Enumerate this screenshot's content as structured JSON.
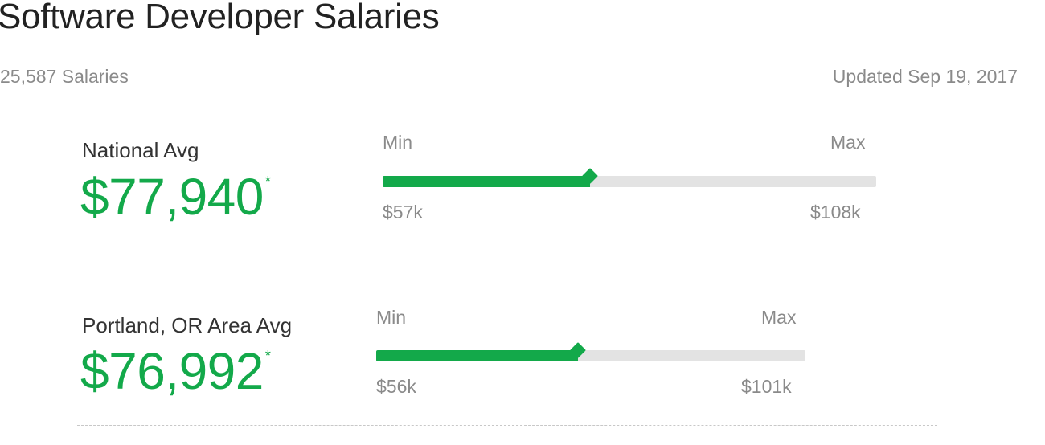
{
  "header": {
    "title": "Software Developer Salaries",
    "salary_count": "25,587 Salaries",
    "updated": "Updated Sep 19, 2017"
  },
  "rows": [
    {
      "label": "National Avg",
      "average": "$77,940",
      "asterisk": "*",
      "min_label": "Min",
      "max_label": "Max",
      "min_value": "$57k",
      "max_value": "$108k",
      "percentile_fill": 0.42
    },
    {
      "label": "Portland, OR Area Avg",
      "average": "$76,992",
      "asterisk": "*",
      "min_label": "Min",
      "max_label": "Max",
      "min_value": "$56k",
      "max_value": "$101k",
      "percentile_fill": 0.47
    }
  ],
  "colors": {
    "accent": "#13a94a",
    "track": "#e3e3e3",
    "muted_text": "#8a8a8a"
  }
}
